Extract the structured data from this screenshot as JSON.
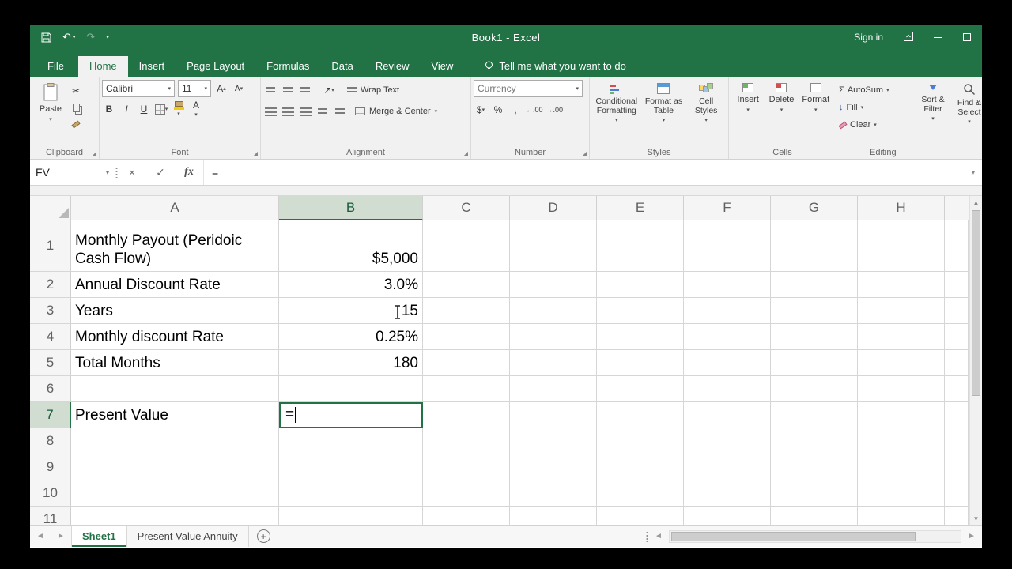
{
  "colors": {
    "excel_green": "#217346",
    "fill_color_swatch": "#F2C811",
    "font_color_swatch": "#E03E3E",
    "insert_accent": "#6db56d",
    "delete_accent": "#d34f4f",
    "cellstyle_orange": "#ffd966",
    "cellstyle_blue": "#9dc3e6",
    "cellstyle_green": "#a9d18e"
  },
  "titlebar": {
    "title": "Book1 - Excel",
    "sign_in": "Sign in"
  },
  "ribbon_tabs": {
    "file": "File",
    "items": [
      "Home",
      "Insert",
      "Page Layout",
      "Formulas",
      "Data",
      "Review",
      "View"
    ],
    "tell_me": "Tell me what you want to do"
  },
  "ribbon": {
    "clipboard": {
      "paste": "Paste",
      "label": "Clipboard"
    },
    "font": {
      "family": "Calibri",
      "size": "11",
      "bold": "B",
      "italic": "I",
      "underline": "U",
      "letter": "A",
      "label": "Font"
    },
    "alignment": {
      "wrap_text": "Wrap Text",
      "merge_center": "Merge & Center",
      "label": "Alignment"
    },
    "number": {
      "format": "Currency",
      "currency": "$",
      "percent": "%",
      "comma": ",",
      "increase_decimal": "←.00",
      "decrease_decimal": "→.00",
      "label": "Number"
    },
    "styles": {
      "conditional_line1": "Conditional",
      "conditional_line2": "Formatting",
      "table_line1": "Format as",
      "table_line2": "Table",
      "cellstyles_line1": "Cell",
      "cellstyles_line2": "Styles",
      "label": "Styles"
    },
    "cells": {
      "insert": "Insert",
      "delete": "Delete",
      "format": "Format",
      "label": "Cells"
    },
    "editing": {
      "sigma": "Σ",
      "autosum": "AutoSum",
      "fill": "Fill",
      "clear": "Clear",
      "sort_line1": "Sort &",
      "sort_line2": "Filter",
      "find_line1": "Find &",
      "find_line2": "Select",
      "az": "A↓Z",
      "label": "Editing"
    }
  },
  "formula_bar": {
    "name_box": "FV",
    "cancel": "×",
    "enter": "✓",
    "insert_function": "fx",
    "content": "="
  },
  "sheet": {
    "columns": [
      "A",
      "B",
      "C",
      "D",
      "E",
      "F",
      "G",
      "H"
    ],
    "active_cell": "B7",
    "rows": [
      {
        "n": "1",
        "a": "Monthly Payout (Peridoic Cash Flow)",
        "b": "$5,000"
      },
      {
        "n": "2",
        "a": "Annual Discount Rate",
        "b": "3.0%"
      },
      {
        "n": "3",
        "a": "Years",
        "b": "15"
      },
      {
        "n": "4",
        "a": "Monthly discount Rate",
        "b": "0.25%"
      },
      {
        "n": "5",
        "a": "Total Months",
        "b": "180"
      },
      {
        "n": "6",
        "a": "",
        "b": ""
      },
      {
        "n": "7",
        "a": "Present Value",
        "b": "="
      },
      {
        "n": "8",
        "a": "",
        "b": ""
      },
      {
        "n": "9",
        "a": "",
        "b": ""
      },
      {
        "n": "10",
        "a": "",
        "b": ""
      },
      {
        "n": "11",
        "a": "",
        "b": ""
      }
    ]
  },
  "sheet_tabs": {
    "active": "Sheet1",
    "second": "Present Value Annuity"
  },
  "glyphs": {
    "caret_down": "▾",
    "caret_up": "▴",
    "undo": "↶",
    "redo": "↷",
    "scissors": "✂",
    "left": "◄",
    "right": "►",
    "up": "▲",
    "down": "▼",
    "arrow_down": "↓",
    "arrow_ne": "↗",
    "plus": "+"
  }
}
